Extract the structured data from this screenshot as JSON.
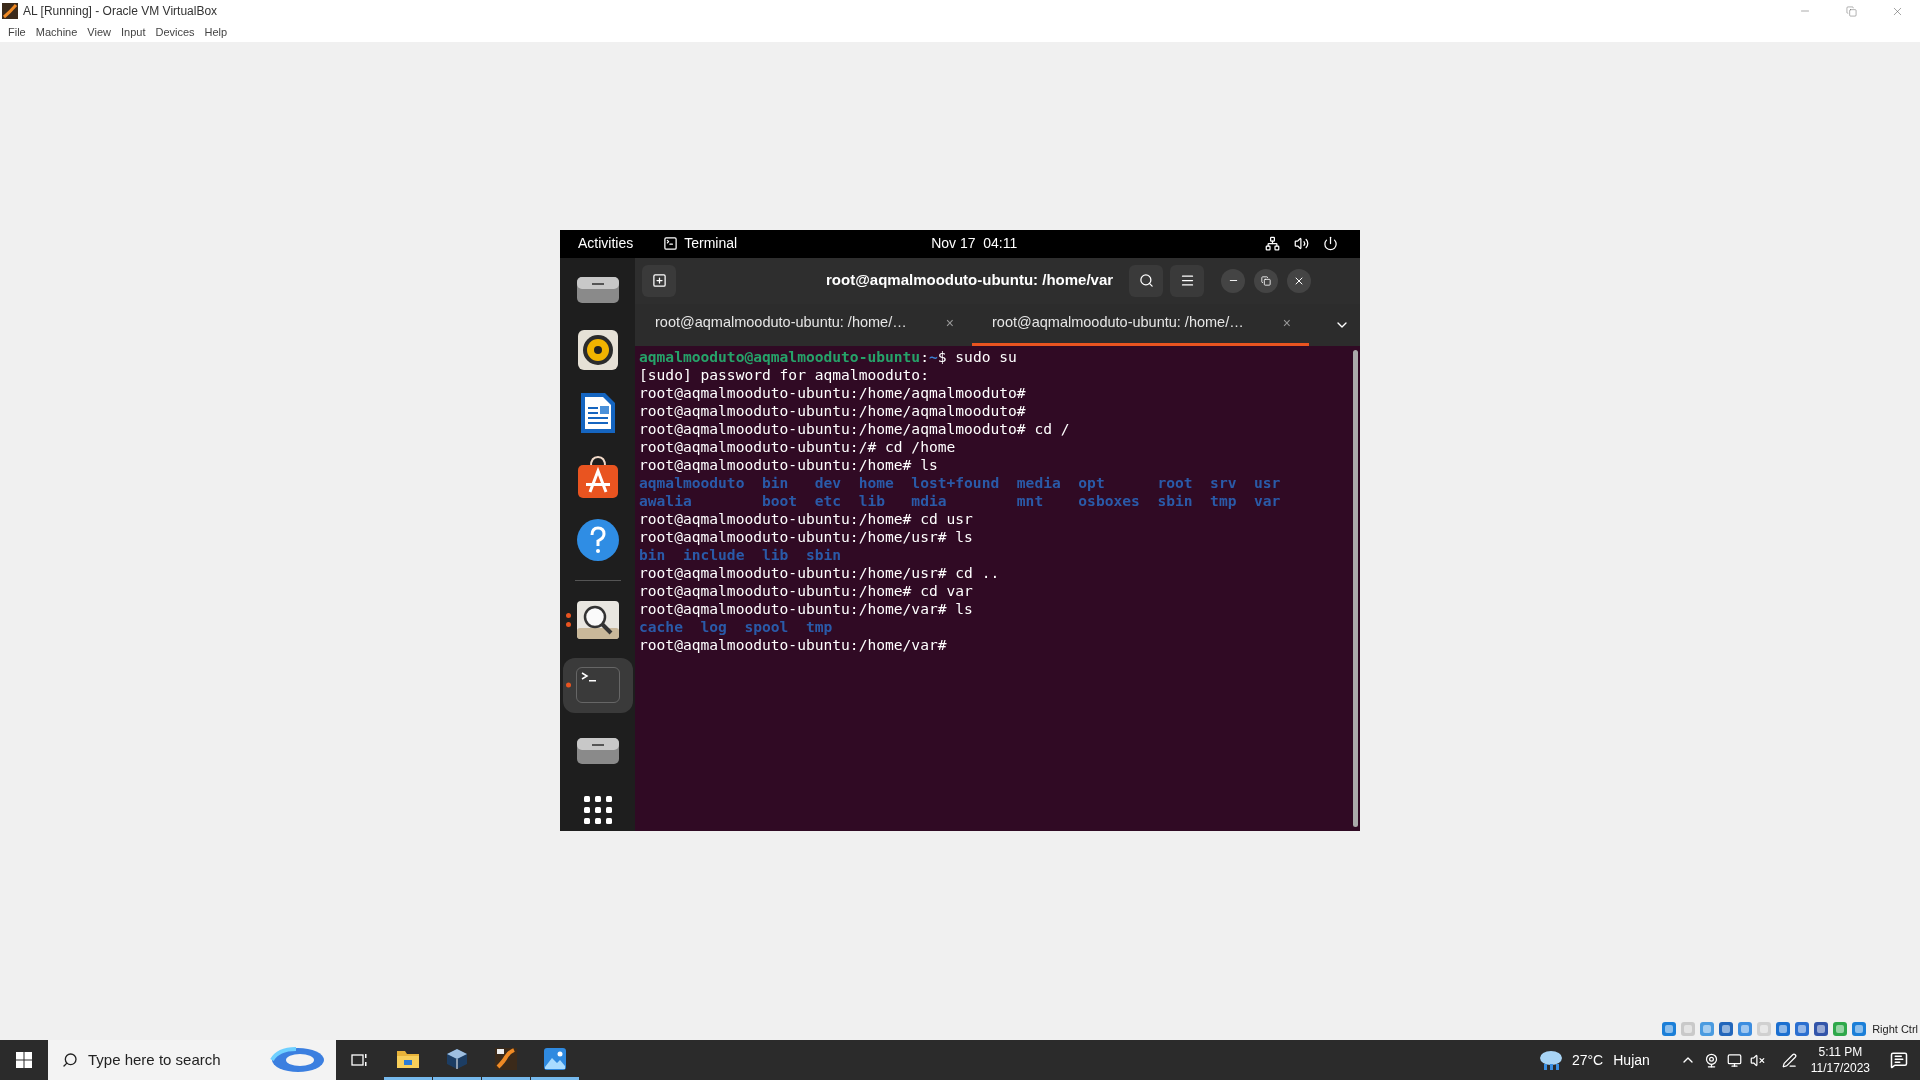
{
  "window": {
    "title": "AL [Running] - Oracle VM VirtualBox"
  },
  "menu": [
    "File",
    "Machine",
    "View",
    "Input",
    "Devices",
    "Help"
  ],
  "vm": {
    "top_bar": {
      "activities": "Activities",
      "app": "Terminal",
      "clock": "Nov 17  04:11"
    },
    "dock": [
      {
        "kind": "drive",
        "running": false,
        "selected": false
      },
      {
        "kind": "speaker",
        "running": false,
        "selected": false
      },
      {
        "kind": "document",
        "running": false,
        "selected": false
      },
      {
        "kind": "store",
        "running": false,
        "selected": false
      },
      {
        "kind": "help",
        "running": false,
        "selected": false
      },
      {
        "kind": "separator"
      },
      {
        "kind": "viewer",
        "running": true,
        "multiple_windows": true,
        "selected": false
      },
      {
        "kind": "terminal",
        "running": true,
        "multiple_windows": false,
        "selected": true
      },
      {
        "kind": "drive",
        "running": false,
        "selected": false
      },
      {
        "kind": "grid",
        "running": false,
        "selected": false
      }
    ],
    "terminal": {
      "title": "root@aqmalmooduto-ubuntu: /home/var",
      "tabs": [
        {
          "label": "root@aqmalmooduto-ubuntu: /home/…",
          "close": "×",
          "selected": false
        },
        {
          "label": "root@aqmalmooduto-ubuntu: /home/…",
          "close": "×",
          "selected": true
        }
      ],
      "lines": [
        [
          {
            "kind": "user",
            "text": "aqmalmooduto@aqmalmooduto-ubuntu"
          },
          {
            "kind": "plain",
            "text": ":"
          },
          {
            "kind": "path",
            "text": "~"
          },
          {
            "kind": "plain",
            "text": "$ sudo su"
          }
        ],
        [
          {
            "kind": "plain",
            "text": "[sudo] password for aqmalmooduto:"
          }
        ],
        [
          {
            "kind": "plain",
            "text": "root@aqmalmooduto-ubuntu:/home/aqmalmooduto#"
          }
        ],
        [
          {
            "kind": "plain",
            "text": "root@aqmalmooduto-ubuntu:/home/aqmalmooduto#"
          }
        ],
        [
          {
            "kind": "plain",
            "text": "root@aqmalmooduto-ubuntu:/home/aqmalmooduto# cd /"
          }
        ],
        [
          {
            "kind": "plain",
            "text": "root@aqmalmooduto-ubuntu:/# cd /home"
          }
        ],
        [
          {
            "kind": "plain",
            "text": "root@aqmalmooduto-ubuntu:/home# ls"
          }
        ],
        [
          {
            "kind": "dir",
            "text": "aqmalmooduto  bin   dev  home  lost+found  media  opt      root  srv  usr"
          }
        ],
        [
          {
            "kind": "dir",
            "text": "awalia        boot  etc  lib   mdia        mnt    osboxes  sbin  tmp  var"
          }
        ],
        [
          {
            "kind": "plain",
            "text": "root@aqmalmooduto-ubuntu:/home# cd usr"
          }
        ],
        [
          {
            "kind": "plain",
            "text": "root@aqmalmooduto-ubuntu:/home/usr# ls"
          }
        ],
        [
          {
            "kind": "dir",
            "text": "bin  include  lib  sbin"
          }
        ],
        [
          {
            "kind": "plain",
            "text": "root@aqmalmooduto-ubuntu:/home/usr# cd .."
          }
        ],
        [
          {
            "kind": "plain",
            "text": "root@aqmalmooduto-ubuntu:/home# cd var"
          }
        ],
        [
          {
            "kind": "plain",
            "text": "root@aqmalmooduto-ubuntu:/home/var# ls"
          }
        ],
        [
          {
            "kind": "dir",
            "text": "cache  log  spool  tmp"
          }
        ],
        [
          {
            "kind": "plain",
            "text": "root@aqmalmooduto-ubuntu:/home/var#"
          }
        ]
      ]
    }
  },
  "status_strip": {
    "host_key": "Right Ctrl"
  },
  "taskbar": {
    "search": {
      "placeholder": "Type here to search"
    },
    "apps": [
      {
        "kind": "folder",
        "running": true
      },
      {
        "kind": "cube",
        "running": true
      },
      {
        "kind": "paint",
        "running": true
      },
      {
        "kind": "photo",
        "running": true
      }
    ],
    "weather": {
      "temperature": "27°C",
      "condition": "Hujan"
    },
    "time": "5:11 PM",
    "date": "11/17/2023"
  }
}
